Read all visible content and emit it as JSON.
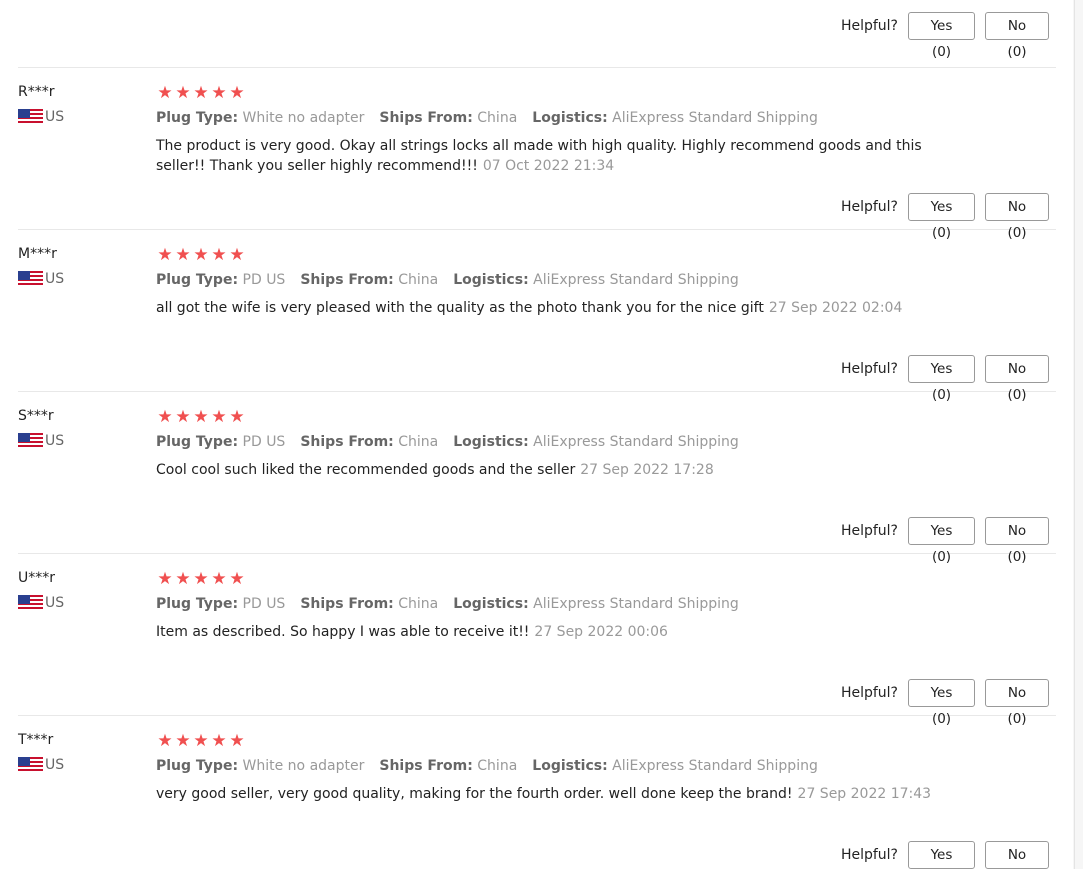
{
  "top": {
    "helpful_label": "Helpful?",
    "yes_label": "Yes (0)",
    "no_label": "No (0)"
  },
  "labels": {
    "plug_type": "Plug Type:",
    "ships_from": "Ships From:",
    "logistics": "Logistics:"
  },
  "colors": {
    "star": "#f05050",
    "divider": "#e8e8e8"
  },
  "reviews": [
    {
      "name": "R***r",
      "country": "US",
      "rating": 5,
      "plug_type": "White no adapter",
      "ships_from": "China",
      "logistics": "AliExpress Standard Shipping",
      "comment": "The product is very good. Okay all strings locks all made with high quality. Highly recommend goods and this seller!! Thank you seller highly recommend!!!",
      "date": "07 Oct 2022 21:34",
      "helpful_label": "Helpful?",
      "yes_label": "Yes (0)",
      "no_label": "No (0)"
    },
    {
      "name": "M***r",
      "country": "US",
      "rating": 5,
      "plug_type": "PD US",
      "ships_from": "China",
      "logistics": "AliExpress Standard Shipping",
      "comment": "all got the wife is very pleased with the quality as the photo thank you for the nice gift",
      "date": "27 Sep 2022 02:04",
      "helpful_label": "Helpful?",
      "yes_label": "Yes (0)",
      "no_label": "No (0)"
    },
    {
      "name": "S***r",
      "country": "US",
      "rating": 5,
      "plug_type": "PD US",
      "ships_from": "China",
      "logistics": "AliExpress Standard Shipping",
      "comment": "Cool cool such liked the recommended goods and the seller",
      "date": "27 Sep 2022 17:28",
      "helpful_label": "Helpful?",
      "yes_label": "Yes (0)",
      "no_label": "No (0)"
    },
    {
      "name": "U***r",
      "country": "US",
      "rating": 5,
      "plug_type": "PD US",
      "ships_from": "China",
      "logistics": "AliExpress Standard Shipping",
      "comment": "Item as described. So happy I was able to receive it!!",
      "date": "27 Sep 2022 00:06",
      "helpful_label": "Helpful?",
      "yes_label": "Yes (0)",
      "no_label": "No (0)"
    },
    {
      "name": "T***r",
      "country": "US",
      "rating": 5,
      "plug_type": "White no adapter",
      "ships_from": "China",
      "logistics": "AliExpress Standard Shipping",
      "comment": "very good seller, very good quality, making for the fourth order. well done keep the brand!",
      "date": "27 Sep 2022 17:43",
      "helpful_label": "Helpful?",
      "yes_label": "Yes (0)",
      "no_label": "No (0)"
    }
  ]
}
